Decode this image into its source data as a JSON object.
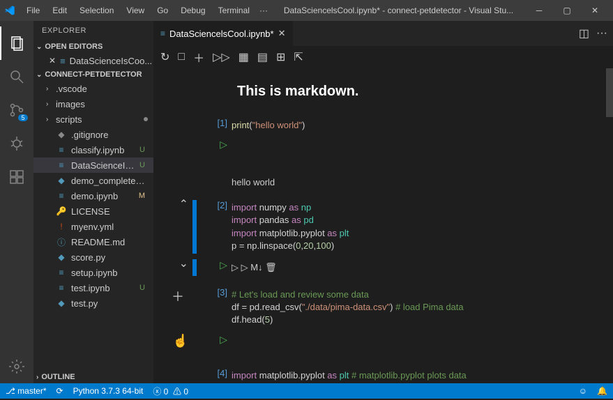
{
  "title": "DataSciencelsCool.ipynb* - connect-petdetector - Visual Stu...",
  "menu": [
    "File",
    "Edit",
    "Selection",
    "View",
    "Go",
    "Debug",
    "Terminal"
  ],
  "menu_dots": "···",
  "actbar": {
    "badge_scm": "5"
  },
  "sidebar": {
    "header": "EXPLORER",
    "open_editors_label": "OPEN EDITORS",
    "open_editor_item": "DataScienceIsCoo...",
    "project_label": "CONNECT-PETDETECTOR",
    "items": [
      {
        "name": ".vscode",
        "folder": true
      },
      {
        "name": "images",
        "folder": true
      },
      {
        "name": "scripts",
        "folder": true,
        "unsaved": true
      },
      {
        "name": ".gitignore",
        "icon": "◆",
        "iconColor": "#888"
      },
      {
        "name": "classify.ipynb",
        "icon": "≡",
        "iconColor": "#519aba",
        "status": "U",
        "green": true
      },
      {
        "name": "DataScienceIsCo...",
        "icon": "≡",
        "iconColor": "#519aba",
        "status": "U",
        "green": true,
        "selected": true
      },
      {
        "name": "demo_completed.py",
        "icon": "◆",
        "iconColor": "#519aba"
      },
      {
        "name": "demo.ipynb",
        "icon": "≡",
        "iconColor": "#519aba",
        "status": "M",
        "orange": true
      },
      {
        "name": "LICENSE",
        "icon": "🔑",
        "iconColor": "#e2c08d"
      },
      {
        "name": "myenv.yml",
        "icon": "!",
        "iconColor": "#cb4b16"
      },
      {
        "name": "README.md",
        "icon": "ⓘ",
        "iconColor": "#519aba"
      },
      {
        "name": "score.py",
        "icon": "◆",
        "iconColor": "#519aba"
      },
      {
        "name": "setup.ipynb",
        "icon": "≡",
        "iconColor": "#519aba"
      },
      {
        "name": "test.ipynb",
        "icon": "≡",
        "iconColor": "#519aba",
        "status": "U",
        "green": true
      },
      {
        "name": "test.py",
        "icon": "◆",
        "iconColor": "#519aba"
      }
    ],
    "outline_label": "OUTLINE"
  },
  "tab": {
    "label": "DataSciencelsCool.ipynb*"
  },
  "cells": {
    "md": "This is markdown.",
    "c1": {
      "prompt": "[1]",
      "code": [
        {
          "t": "print",
          "c": "tok-fn"
        },
        {
          "t": "(",
          "c": "tok-pun"
        },
        {
          "t": "\"hello world\"",
          "c": "tok-str"
        },
        {
          "t": ")",
          "c": "tok-pun"
        }
      ],
      "output": "hello world"
    },
    "c2": {
      "prompt": "[2]",
      "lines": [
        [
          {
            "t": "import",
            "c": "tok-kw"
          },
          {
            "t": " numpy ",
            "c": "tok-id"
          },
          {
            "t": "as",
            "c": "tok-kw"
          },
          {
            "t": " np",
            "c": "tok-mod"
          }
        ],
        [
          {
            "t": "import",
            "c": "tok-kw"
          },
          {
            "t": " pandas ",
            "c": "tok-id"
          },
          {
            "t": "as",
            "c": "tok-kw"
          },
          {
            "t": " pd",
            "c": "tok-mod"
          }
        ],
        [
          {
            "t": "import",
            "c": "tok-kw"
          },
          {
            "t": " matplotlib.pyplot ",
            "c": "tok-id"
          },
          {
            "t": "as",
            "c": "tok-kw"
          },
          {
            "t": " plt",
            "c": "tok-mod"
          }
        ],
        [
          {
            "t": "p = np.linspace(",
            "c": "tok-id"
          },
          {
            "t": "0",
            "c": "tok-num"
          },
          {
            "t": ",",
            "c": "tok-pun"
          },
          {
            "t": "20",
            "c": "tok-num"
          },
          {
            "t": ",",
            "c": "tok-pun"
          },
          {
            "t": "100",
            "c": "tok-num"
          },
          {
            "t": ")",
            "c": "tok-pun"
          }
        ]
      ],
      "toolbar": "▷  ▷  M↓  🗑"
    },
    "c3": {
      "prompt": "[3]",
      "lines": [
        [
          {
            "t": "# Let's load and review some data",
            "c": "tok-cmt"
          }
        ],
        [
          {
            "t": "df = pd.read_csv(",
            "c": "tok-id"
          },
          {
            "t": "\"./data/pima-data.csv\"",
            "c": "tok-str"
          },
          {
            "t": ") ",
            "c": "tok-pun"
          },
          {
            "t": "# load Pima data",
            "c": "tok-cmt"
          }
        ],
        [
          {
            "t": "df.head(",
            "c": "tok-id"
          },
          {
            "t": "5",
            "c": "tok-num"
          },
          {
            "t": ")",
            "c": "tok-pun"
          }
        ]
      ]
    },
    "c4": {
      "prompt": "[4]",
      "lines": [
        [
          {
            "t": "import",
            "c": "tok-kw"
          },
          {
            "t": " matplotlib.pyplot ",
            "c": "tok-id"
          },
          {
            "t": "as",
            "c": "tok-kw"
          },
          {
            "t": " plt ",
            "c": "tok-mod"
          },
          {
            "t": "# matplotlib.pyplot plots data",
            "c": "tok-cmt"
          }
        ]
      ]
    }
  },
  "status": {
    "branch": "master*",
    "python": "Python 3.7.3 64-bit",
    "err": "0",
    "warn": "0"
  }
}
